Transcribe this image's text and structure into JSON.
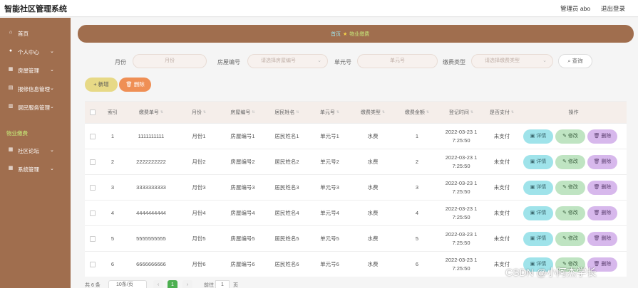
{
  "header": {
    "title": "智能社区管理系统",
    "admin": "管理员 abo",
    "logout": "退出登录"
  },
  "sidebar": {
    "items": [
      {
        "icon": "⌂",
        "label": "首页",
        "chevron": ""
      },
      {
        "icon": "●",
        "label": "个人中心",
        "chevron": "⌄"
      },
      {
        "icon": "▦",
        "label": "房屋管理",
        "chevron": "⌄"
      },
      {
        "icon": "▤",
        "label": "报修信息管理",
        "chevron": "⌄"
      },
      {
        "icon": "▥",
        "label": "居民服务管理",
        "chevron": "⌄"
      },
      {
        "icon": "",
        "label": "物业缴费",
        "chevron": ""
      },
      {
        "icon": "▦",
        "label": "社区论坛",
        "chevron": "⌄"
      },
      {
        "icon": "▦",
        "label": "系统管理",
        "chevron": "⌄"
      }
    ]
  },
  "breadcrumb": {
    "home": "首页",
    "sep": "★",
    "current": "物业缴费"
  },
  "search": {
    "month_label": "月份",
    "month_placeholder": "月份",
    "house_label": "房屋编号",
    "house_placeholder": "请选择房屋编号",
    "unit_label": "单元号",
    "unit_placeholder": "单元号",
    "pay_label": "缴费类型",
    "pay_placeholder": "请选择缴费类型",
    "query": "查询"
  },
  "actions": {
    "add": "新增",
    "delete": "删除"
  },
  "table": {
    "headers": [
      "索引",
      "缴费单号",
      "月份",
      "房屋编号",
      "居民姓名",
      "单元号",
      "缴费类型",
      "缴费金额",
      "登记时间",
      "是否支付",
      "操作"
    ],
    "rows": [
      {
        "idx": "1",
        "no": "1111111111",
        "month": "月份1",
        "house": "房屋编号1",
        "name": "居民姓名1",
        "unit": "单元号1",
        "type": "水费",
        "amount": "1",
        "date": "2022-03-23 1",
        "time": "7:25:50",
        "paid": "未支付"
      },
      {
        "idx": "2",
        "no": "2222222222",
        "month": "月份2",
        "house": "房屋编号2",
        "name": "居民姓名2",
        "unit": "单元号2",
        "type": "水费",
        "amount": "2",
        "date": "2022-03-23 1",
        "time": "7:25:50",
        "paid": "未支付"
      },
      {
        "idx": "3",
        "no": "3333333333",
        "month": "月份3",
        "house": "房屋编号3",
        "name": "居民姓名3",
        "unit": "单元号3",
        "type": "水费",
        "amount": "3",
        "date": "2022-03-23 1",
        "time": "7:25:50",
        "paid": "未支付"
      },
      {
        "idx": "4",
        "no": "4444444444",
        "month": "月份4",
        "house": "房屋编号4",
        "name": "居民姓名4",
        "unit": "单元号4",
        "type": "水费",
        "amount": "4",
        "date": "2022-03-23 1",
        "time": "7:25:50",
        "paid": "未支付"
      },
      {
        "idx": "5",
        "no": "5555555555",
        "month": "月份5",
        "house": "房屋编号5",
        "name": "居民姓名5",
        "unit": "单元号5",
        "type": "水费",
        "amount": "5",
        "date": "2022-03-23 1",
        "time": "7:25:50",
        "paid": "未支付"
      },
      {
        "idx": "6",
        "no": "6666666666",
        "month": "月份6",
        "house": "房屋编号6",
        "name": "居民姓名6",
        "unit": "单元号6",
        "type": "水费",
        "amount": "6",
        "date": "2022-03-23 1",
        "time": "7:25:50",
        "paid": "未支付"
      }
    ],
    "ops": {
      "detail": "详情",
      "edit": "修改",
      "delete": "删除"
    }
  },
  "pagination": {
    "total": "共 6 条",
    "page_size": "10条/页",
    "prev": "‹",
    "current": "1",
    "next": "›",
    "goto": "前往",
    "goto_value": "1",
    "unit": "页"
  },
  "watermark": "CSDN @小阿杰学长",
  "colors": {
    "sidebar": "#a06e4e",
    "add": "#e7d986",
    "delete": "#ef8f55",
    "detail": "#9fe3ea",
    "edit": "#bfe4c2",
    "row_delete": "#d7b8ec",
    "current_page": "#4caf50"
  }
}
